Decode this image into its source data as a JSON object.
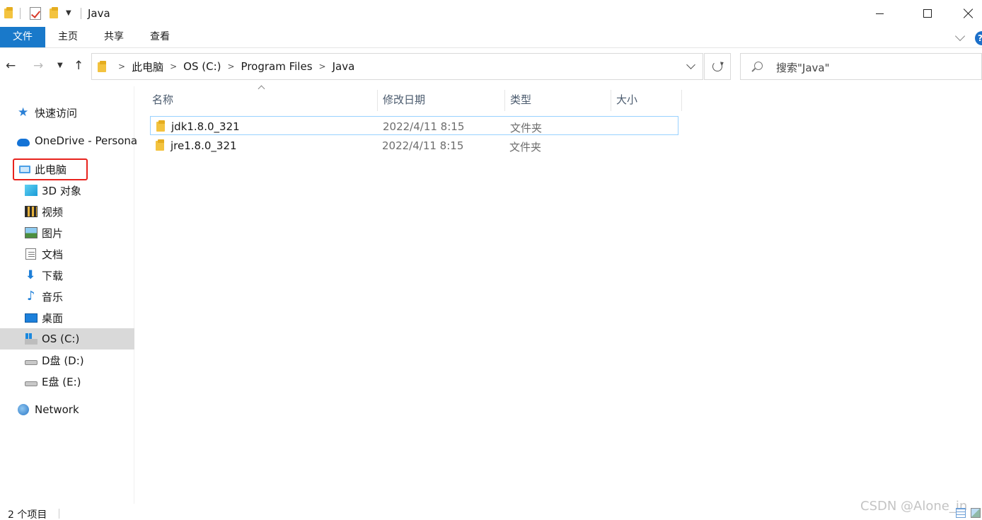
{
  "window": {
    "title": "Java"
  },
  "ribbon": {
    "tabs": [
      {
        "label": "文件",
        "active": true
      },
      {
        "label": "主页",
        "active": false
      },
      {
        "label": "共享",
        "active": false
      },
      {
        "label": "查看",
        "active": false
      }
    ],
    "help_label": "?"
  },
  "address": {
    "crumbs": [
      "此电脑",
      "OS (C:)",
      "Program Files",
      "Java"
    ],
    "separator": ">"
  },
  "search": {
    "placeholder": "搜索\"Java\""
  },
  "sidebar": {
    "items": [
      {
        "label": "快速访问",
        "icon": "star-icon"
      },
      {
        "label": "OneDrive - Persona",
        "icon": "cloud-icon"
      },
      {
        "label": "此电脑",
        "icon": "computer-icon",
        "highlighted": true
      },
      {
        "label": "3D 对象",
        "icon": "cube-icon"
      },
      {
        "label": "视频",
        "icon": "video-icon"
      },
      {
        "label": "图片",
        "icon": "picture-icon"
      },
      {
        "label": "文档",
        "icon": "document-icon"
      },
      {
        "label": "下载",
        "icon": "download-icon"
      },
      {
        "label": "音乐",
        "icon": "music-icon"
      },
      {
        "label": "桌面",
        "icon": "desktop-icon"
      },
      {
        "label": "OS (C:)",
        "icon": "os-drive-icon",
        "selected": true
      },
      {
        "label": "D盘 (D:)",
        "icon": "drive-icon"
      },
      {
        "label": "E盘 (E:)",
        "icon": "drive-icon"
      },
      {
        "label": "Network",
        "icon": "network-icon"
      }
    ]
  },
  "columns": {
    "name": "名称",
    "date": "修改日期",
    "type": "类型",
    "size": "大小"
  },
  "files": [
    {
      "name": "jdk1.8.0_321",
      "date": "2022/4/11 8:15",
      "type": "文件夹"
    },
    {
      "name": "jre1.8.0_321",
      "date": "2022/4/11 8:15",
      "type": "文件夹"
    }
  ],
  "status": {
    "item_count": "2 个项目"
  },
  "watermark": "CSDN @Alone_in",
  "colors": {
    "accent": "#1979ca",
    "highlight_border": "#e8231d",
    "folder": "#f3c33f"
  }
}
